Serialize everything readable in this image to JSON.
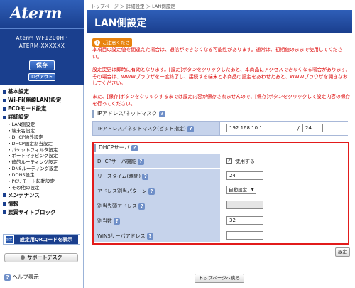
{
  "brand": {
    "logo": "Aterm",
    "model_line1": "Aterm WF1200HP",
    "model_line2": "ATERM-XXXXXX",
    "save": "保存",
    "logout": "ログアウト"
  },
  "menu": [
    {
      "label": "基本設定",
      "level": 1
    },
    {
      "label": "Wi-Fi(無線LAN)設定",
      "level": 1
    },
    {
      "label": "ECOモード設定",
      "level": 1
    },
    {
      "label": "詳細設定",
      "level": 1
    },
    {
      "label": "LAN側設定",
      "level": 2
    },
    {
      "label": "端末名設定",
      "level": 2
    },
    {
      "label": "DHCP除外設定",
      "level": 2
    },
    {
      "label": "DHCP固定割当設定",
      "level": 2
    },
    {
      "label": "パケットフィルタ設定",
      "level": 2
    },
    {
      "label": "ポートマッピング設定",
      "level": 2
    },
    {
      "label": "静的ルーティング設定",
      "level": 2
    },
    {
      "label": "DNSルーティング設定",
      "level": 2
    },
    {
      "label": "DDNS設定",
      "level": 2
    },
    {
      "label": "PCリモート起動設定",
      "level": 2
    },
    {
      "label": "その他の設定",
      "level": 2
    },
    {
      "label": "メンテナンス",
      "level": 1
    },
    {
      "label": "情報",
      "level": 1
    },
    {
      "label": "悪質サイトブロック",
      "level": 1
    }
  ],
  "qr_button": {
    "icon_text": "設定用",
    "label": "設定用QRコードを表示"
  },
  "support": "サポートデスク",
  "help": "ヘルプ表示",
  "breadcrumb": "トップページ ＞ 詳細設定 ＞ LAN側設定",
  "page_title": "LAN側設定",
  "caution": {
    "label": "ご注意ください",
    "w1": "本項目の設定値を間違えた場合は、通信ができなくなる可能性があります。通常は、初期値のままで使用してください。",
    "w2": "設定変更は即時に有効となります。[設定]ボタンをクリックしたあと、本商品にアクセスできなくなる場合があります。その場合は、WWWブラウザを一度終了し、接続する端末と本商品の設定をあわせたあと、WWWブラウザを開きなおしてください。",
    "w3": "また、[保存]ボタンをクリックするまでは設定内容が保存されませんので、[保存]ボタンをクリックして設定内容の保存を行ってください。"
  },
  "ip_section": {
    "title": "IPアドレス/ネットマスク",
    "row_label": "IPアドレス／ネットマスク(ビット指定)",
    "ip": "192.168.10.1",
    "slash": "/",
    "mask": "24"
  },
  "dhcp": {
    "title": "DHCPサーバ",
    "rows": [
      {
        "label": "DHCPサーバ機能",
        "value": "使用する",
        "checked": true
      },
      {
        "label": "リースタイム(時間)",
        "value": "24"
      },
      {
        "label": "アドレス割当パターン",
        "value": "自動設定"
      },
      {
        "label": "割当先頭アドレス",
        "value": ""
      },
      {
        "label": "割当数",
        "value": "32"
      },
      {
        "label": "WINSサーバアドレス",
        "value": ""
      }
    ]
  },
  "buttons": {
    "set": "設定",
    "top": "トップページへ戻る"
  }
}
